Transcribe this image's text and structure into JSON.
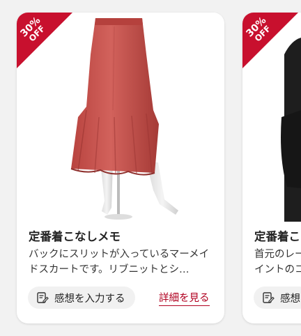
{
  "cards": [
    {
      "badge": {
        "percent": "30%",
        "off": "OFF"
      },
      "image_subject": "red mermaid skirt on mannequin",
      "title": "定番着こなしメモ",
      "description": "バックにスリットが入っているマーメイドスカートです。リブニットとシ…",
      "impression_label": "感想を入力する",
      "detail_label": "詳細を見る"
    },
    {
      "badge": {
        "percent": "30%",
        "off": "OFF"
      },
      "image_subject": "black knit sweater",
      "title": "定番着こ",
      "description_line1": "首元のレー",
      "description_line2": "イントのコ",
      "impression_label": "感想"
    }
  ],
  "colors": {
    "accent": "#c8102e",
    "link": "#b00020",
    "skirt": "#c9534f",
    "background": "#f2f2f2"
  },
  "icons": [
    "edit-note-icon"
  ]
}
